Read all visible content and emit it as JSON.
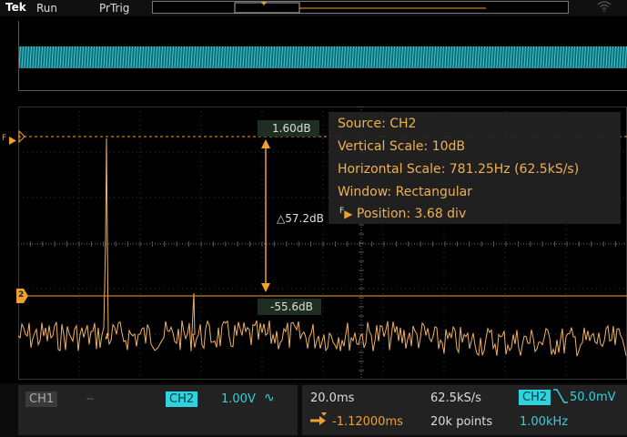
{
  "status_bar": {
    "logo": "Tek",
    "run_state": "Run",
    "trigger_mode": "PrTrig"
  },
  "markers": {
    "trigger_marker": "F",
    "ref_marker": "2",
    "cursor_top_value": "1.60dB",
    "cursor_delta_value": "△57.2dB",
    "cursor_bottom_value": "-55.6dB"
  },
  "info_box": {
    "source": "Source: CH2",
    "vertical_scale": "Vertical Scale: 10dB",
    "horizontal_scale": "Horizontal Scale: 781.25Hz (62.5kS/s)",
    "window": "Window: Rectangular",
    "position_prefix": "F",
    "position": "Position: 3.68 div"
  },
  "channels": {
    "ch1_label": "CH1",
    "ch1_value": "--",
    "ch2_label": "CH2",
    "ch2_value": "1.00V",
    "ch2_coupling": "∿"
  },
  "horizontal": {
    "time_div": "20.0ms",
    "sample_rate": "62.5kS/s",
    "delay": "-1.12000ms",
    "record_length": "20k points"
  },
  "trigger": {
    "source": "CH2",
    "slope_icon": "falling-edge",
    "level": "50.0mV",
    "frequency": "1.00kHz"
  },
  "colors": {
    "ch1": "#3a3a3a",
    "ch2": "#2fd3e0",
    "math_trace": "#f0b060",
    "cursor": "#f0a030"
  }
}
